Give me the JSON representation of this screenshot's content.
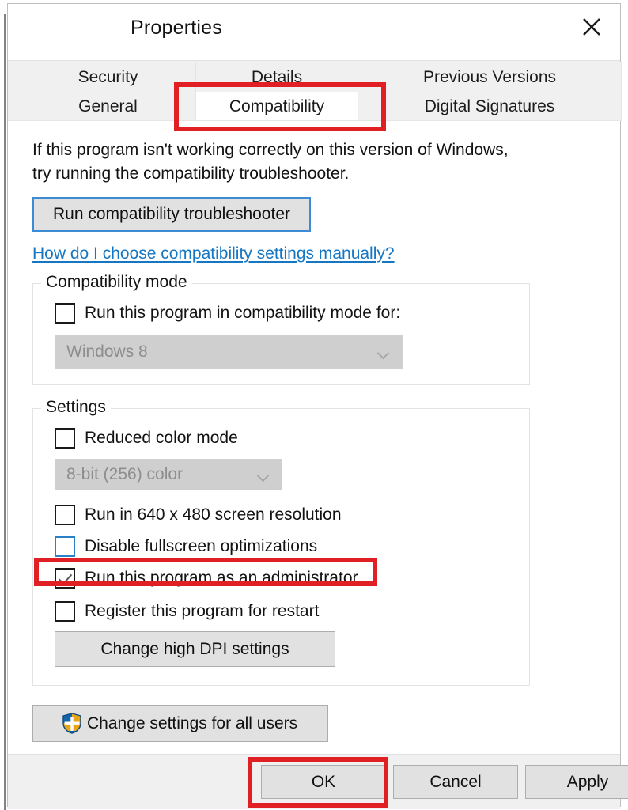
{
  "window": {
    "title": "Properties",
    "close_icon": "close-icon"
  },
  "tabs": {
    "row1": [
      {
        "label": "Security",
        "active": false
      },
      {
        "label": "Details",
        "active": false
      },
      {
        "label": "Previous Versions",
        "active": false
      }
    ],
    "row2": [
      {
        "label": "General",
        "active": false
      },
      {
        "label": "Compatibility",
        "active": true
      },
      {
        "label": "Digital Signatures",
        "active": false
      }
    ]
  },
  "main": {
    "intro_line1": "If this program isn't working correctly on this version of Windows,",
    "intro_line2": "try running the compatibility troubleshooter.",
    "troubleshoot_button": "Run compatibility troubleshooter",
    "help_link": "How do I choose compatibility settings manually?"
  },
  "compatibility_mode": {
    "group_title": "Compatibility mode",
    "checkbox_label": "Run this program in compatibility mode for:",
    "checkbox_checked": false,
    "dropdown_value": "Windows 8",
    "dropdown_enabled": false,
    "dropdown_icon": "chevron-down-icon"
  },
  "settings": {
    "group_title": "Settings",
    "reduced_color_label": "Reduced color mode",
    "reduced_color_checked": false,
    "color_depth_value": "8-bit (256) color",
    "color_depth_enabled": false,
    "color_depth_icon": "chevron-down-icon",
    "resolution_label": "Run in 640 x 480 screen resolution",
    "resolution_checked": false,
    "fullscreen_label": "Disable fullscreen optimizations",
    "fullscreen_checked": false,
    "fullscreen_focused": true,
    "admin_label": "Run this program as an administrator",
    "admin_checked": true,
    "restart_label": "Register this program for restart",
    "restart_checked": false,
    "dpi_button": "Change high DPI settings"
  },
  "all_users": {
    "button_label": "Change settings for all users",
    "shield_icon": "uac-shield-icon"
  },
  "footer": {
    "ok": "OK",
    "cancel": "Cancel",
    "apply": "Apply"
  },
  "annotations": {
    "highlight_color": "#e12026",
    "boxes": [
      {
        "target": "Compatibility tab"
      },
      {
        "target": "Run this program as an administrator"
      },
      {
        "target": "OK"
      }
    ]
  },
  "colors": {
    "accent_link": "#1577c4",
    "focus_border": "#3d8bd4",
    "dialog_bg": "#ffffff",
    "chrome_bg": "#f0f0f0",
    "button_face": "#e1e1e1",
    "disabled_field": "#cfcfcf",
    "annotation_red": "#e12026"
  }
}
